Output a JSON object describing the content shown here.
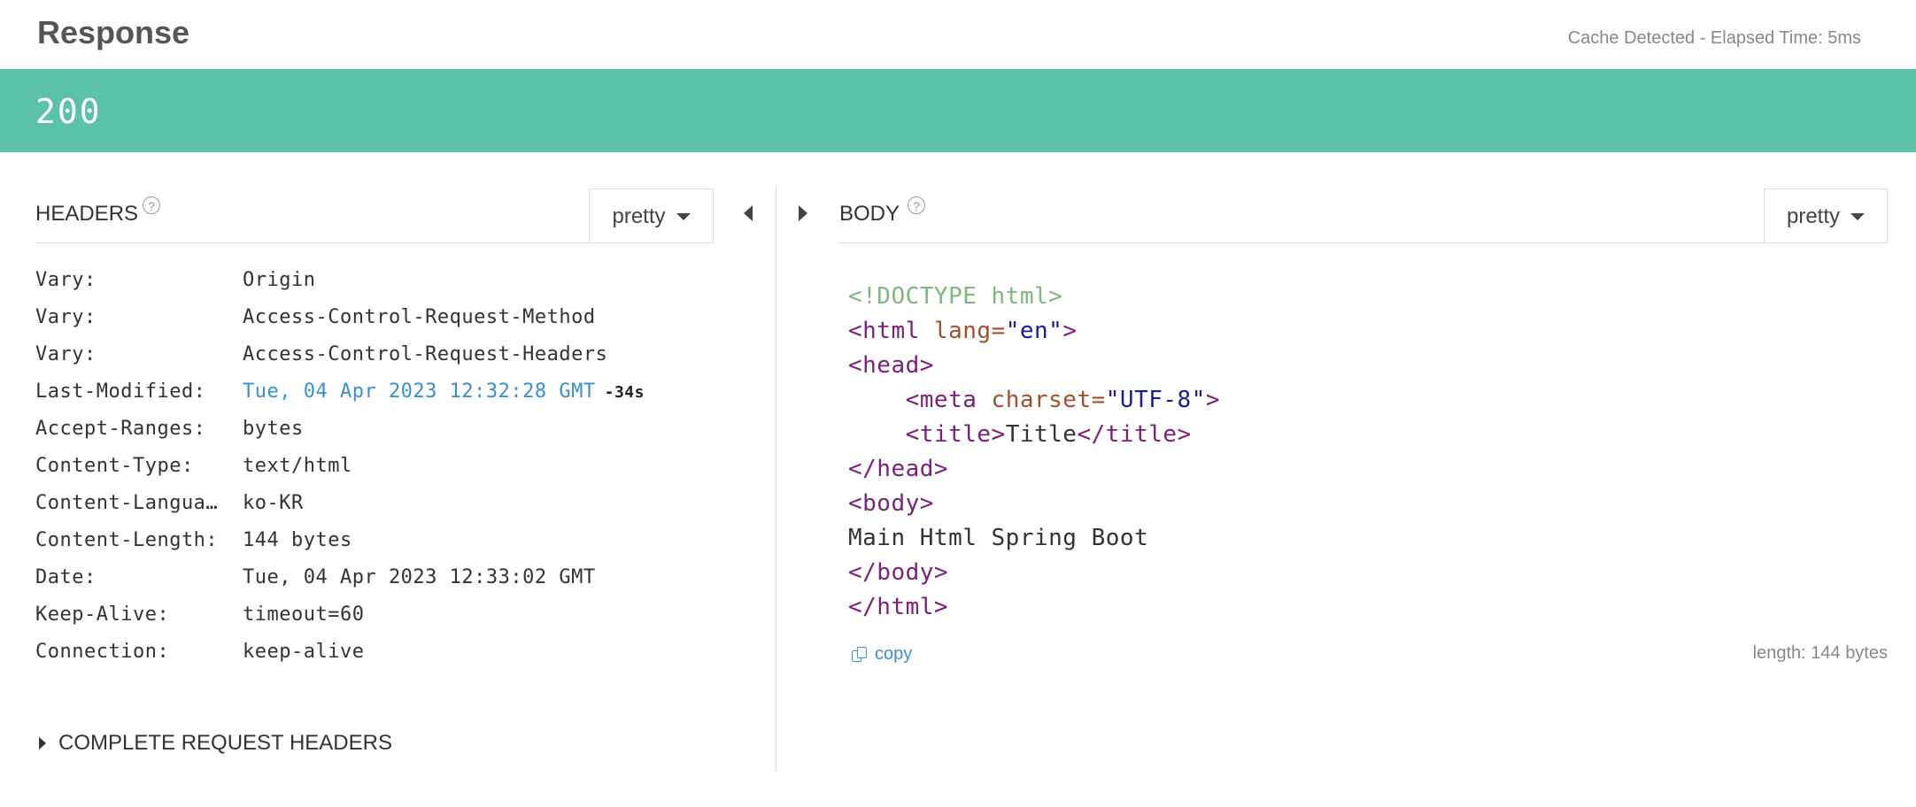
{
  "header": {
    "title": "Response",
    "elapsed_text": "Cache Detected - Elapsed Time: 5ms"
  },
  "status": {
    "code": "200",
    "color": "#5bc2a5"
  },
  "headers_panel": {
    "title": "HEADERS",
    "help_glyph": "?",
    "format_label": "pretty",
    "rows": [
      {
        "name": "Vary:",
        "value": "Origin"
      },
      {
        "name": "Vary:",
        "value": "Access-Control-Request-Method"
      },
      {
        "name": "Vary:",
        "value": "Access-Control-Request-Headers"
      },
      {
        "name": "Last-Modified:",
        "value": "Tue, 04 Apr 2023 12:32:28 GMT",
        "delta": "-34s"
      },
      {
        "name": "Accept-Ranges:",
        "value": "bytes"
      },
      {
        "name": "Content-Type:",
        "value": "text/html"
      },
      {
        "name": "Content-Langua…",
        "value": "ko-KR"
      },
      {
        "name": "Content-Length:",
        "value": "144 bytes"
      },
      {
        "name": "Date:",
        "value": "Tue, 04 Apr 2023 12:33:02 GMT"
      },
      {
        "name": "Keep-Alive:",
        "value": "timeout=60"
      },
      {
        "name": "Connection:",
        "value": "keep-alive"
      }
    ],
    "complete_label": "COMPLETE REQUEST HEADERS"
  },
  "body_panel": {
    "title": "BODY",
    "help_glyph": "?",
    "format_label": "pretty",
    "code": {
      "doctype": "<!DOCTYPE html>",
      "html_open": "<html",
      "lang_attr": " lang=",
      "lang_val": "\"en\"",
      "gt": ">",
      "head_open": "<head>",
      "meta_open": "    <meta",
      "charset_attr": " charset=",
      "charset_val": "\"UTF-8\"",
      "title_open": "    <title>",
      "title_text": "Title",
      "title_close": "</title>",
      "head_close": "</head>",
      "body_open": "<body>",
      "body_text": "Main Html Spring Boot",
      "body_close": "</body>",
      "html_close": "</html>"
    },
    "copy_label": "copy",
    "length_text": "length: 144 bytes"
  }
}
